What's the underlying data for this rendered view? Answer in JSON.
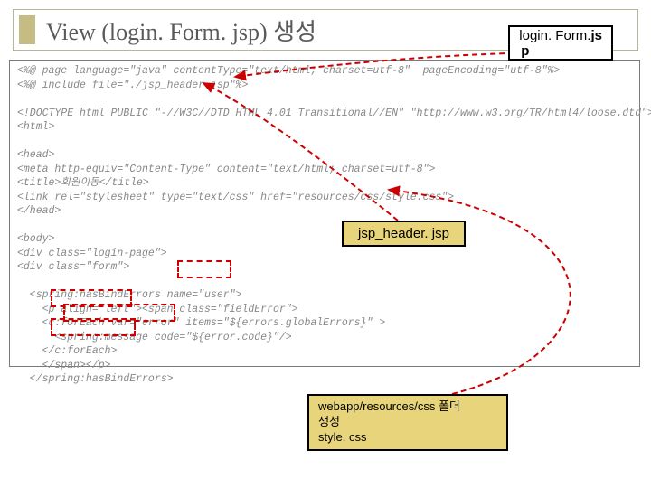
{
  "title": "View (login. Form. jsp) 생성",
  "file_label": {
    "name": "login. Form.",
    "ext_top": "js",
    "ext_bottom": "p"
  },
  "code_lines": [
    "<%@ page language=\"java\" contentType=\"text/html; charset=utf-8\"  pageEncoding=\"utf-8\"%>",
    "<%@ include file=\"./jsp_header.jsp\"%>",
    "",
    "<!DOCTYPE html PUBLIC \"-//W3C//DTD HTML 4.01 Transitional//EN\" \"http://www.w3.org/TR/html4/loose.dtd\">",
    "<html>",
    "",
    "<head>",
    "<meta http-equiv=\"Content-Type\" content=\"text/html; charset=utf-8\">",
    "<title>회원이동</title>",
    "<link rel=\"stylesheet\" type=\"text/css\" href=\"resources/css/style.css\">",
    "</head>",
    "",
    "<body>",
    "<div class=\"login-page\">",
    "<div class=\"form\">",
    "",
    "  <spring:hasBindErrors name=\"user\">",
    "    <p align=\"left\"><span class=\"fieldError\">",
    "    <c:forEach var=\"error\" items=\"${errors.globalErrors}\" >",
    "      <spring:message code=\"${error.code}\"/>",
    "    </c:forEach>",
    "    </span></p>",
    "  </spring:hasBindErrors>"
  ],
  "jsp_header_label": "jsp_header. jsp",
  "css_label_line1": "webapp/resources/css 폴더",
  "css_label_line2": "생성",
  "css_label_line3": "style. css"
}
